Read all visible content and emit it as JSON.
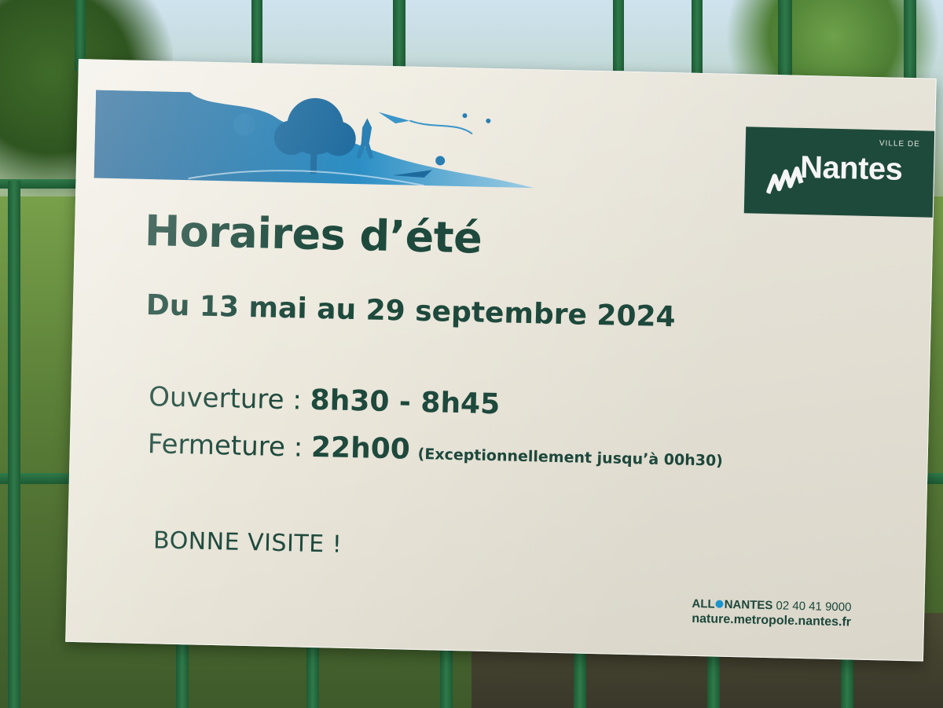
{
  "sign": {
    "logo": {
      "small_text": "VILLE DE",
      "name": "Nantes"
    },
    "title": "Horaires d’été",
    "dates": "Du 13 mai au 29 septembre 2024",
    "opening": {
      "label": "Ouverture : ",
      "value": "8h30 - 8h45"
    },
    "closing": {
      "label": "Fermeture : ",
      "value": "22h00",
      "note": "(Exceptionnellement jusqu’à 00h30)"
    },
    "greeting": "BONNE VISITE !",
    "contact": {
      "brand_left": "ALL",
      "brand_right": "NANTES",
      "phone": "02 40 41 9000",
      "website": "nature.metropole.nantes.fr"
    }
  },
  "colors": {
    "ink": "#1e4a3d",
    "logo_background": "#1f4d3d",
    "banner_blue": "#1a7bb0",
    "fence_green": "#2f7a4a",
    "accent_dot": "#1e9ad6"
  }
}
